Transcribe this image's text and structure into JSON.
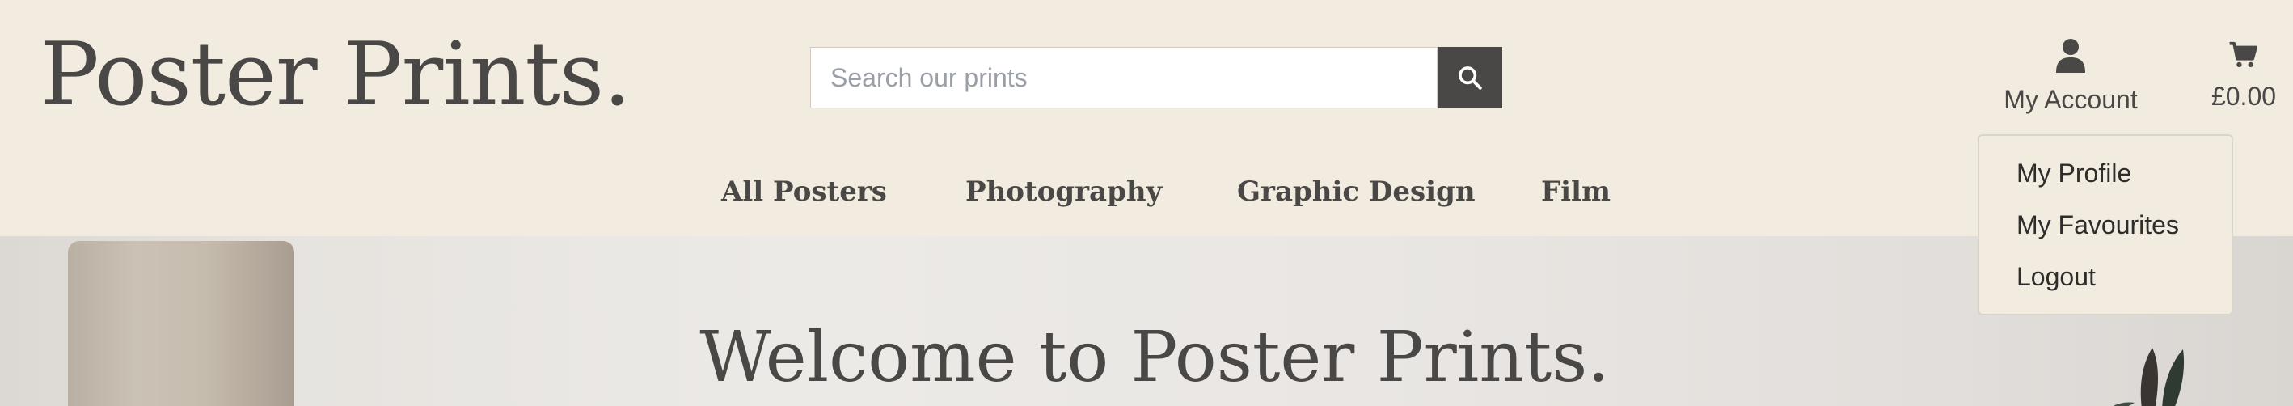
{
  "brand": {
    "logo_text": "Poster Prints."
  },
  "search": {
    "placeholder": "Search our prints",
    "value": ""
  },
  "account": {
    "label": "My Account",
    "icon": "user-icon"
  },
  "cart": {
    "total": "£0.00",
    "icon": "cart-icon"
  },
  "account_menu": {
    "items": [
      {
        "label": "My Profile"
      },
      {
        "label": "My Favourites"
      },
      {
        "label": "Logout"
      }
    ]
  },
  "nav": {
    "items": [
      {
        "label": "All Posters"
      },
      {
        "label": "Photography"
      },
      {
        "label": "Graphic Design"
      },
      {
        "label": "Film"
      }
    ]
  },
  "hero": {
    "title": "Welcome to Poster Prints."
  },
  "colors": {
    "header_bg": "#f1ecdf",
    "text": "#4a4846",
    "button_bg": "#4a4846"
  }
}
